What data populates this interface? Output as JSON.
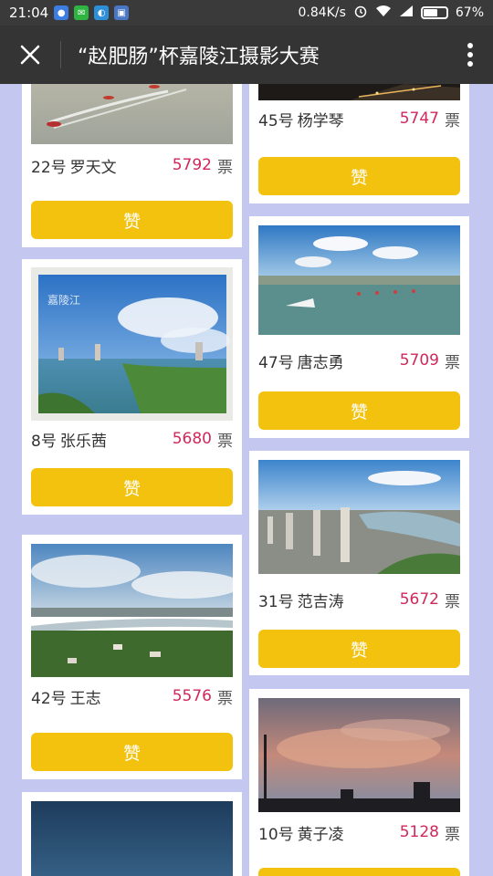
{
  "status_bar": {
    "time": "21:04",
    "network_speed": "0.84K/s",
    "battery": "67%",
    "battery_level": 0.67,
    "icons": [
      "app-icon-1",
      "wechat-icon",
      "app-icon-2",
      "app-icon-3",
      "alarm-icon",
      "wifi-icon",
      "signal-icon",
      "battery-icon"
    ]
  },
  "header": {
    "title": "“赵肥肠”杯嘉陵江摄影大赛",
    "close_icon": "close-icon",
    "more_icon": "more-vertical-icon"
  },
  "like_label": "赞",
  "votes_unit": "票",
  "cards_left": [
    {
      "number": "22号",
      "name": "罗天文",
      "votes": "5792"
    },
    {
      "number": "8号",
      "name": "张乐茜",
      "votes": "5680"
    },
    {
      "number": "42号",
      "name": "王志",
      "votes": "5576"
    }
  ],
  "cards_right": [
    {
      "number": "45号",
      "name": "杨学琴",
      "votes": "5747"
    },
    {
      "number": "47号",
      "name": "唐志勇",
      "votes": "5709"
    },
    {
      "number": "31号",
      "name": "范吉涛",
      "votes": "5672"
    },
    {
      "number": "10号",
      "name": "黄子凌",
      "votes": "5128"
    }
  ],
  "photo_caption": "嘉陵江"
}
